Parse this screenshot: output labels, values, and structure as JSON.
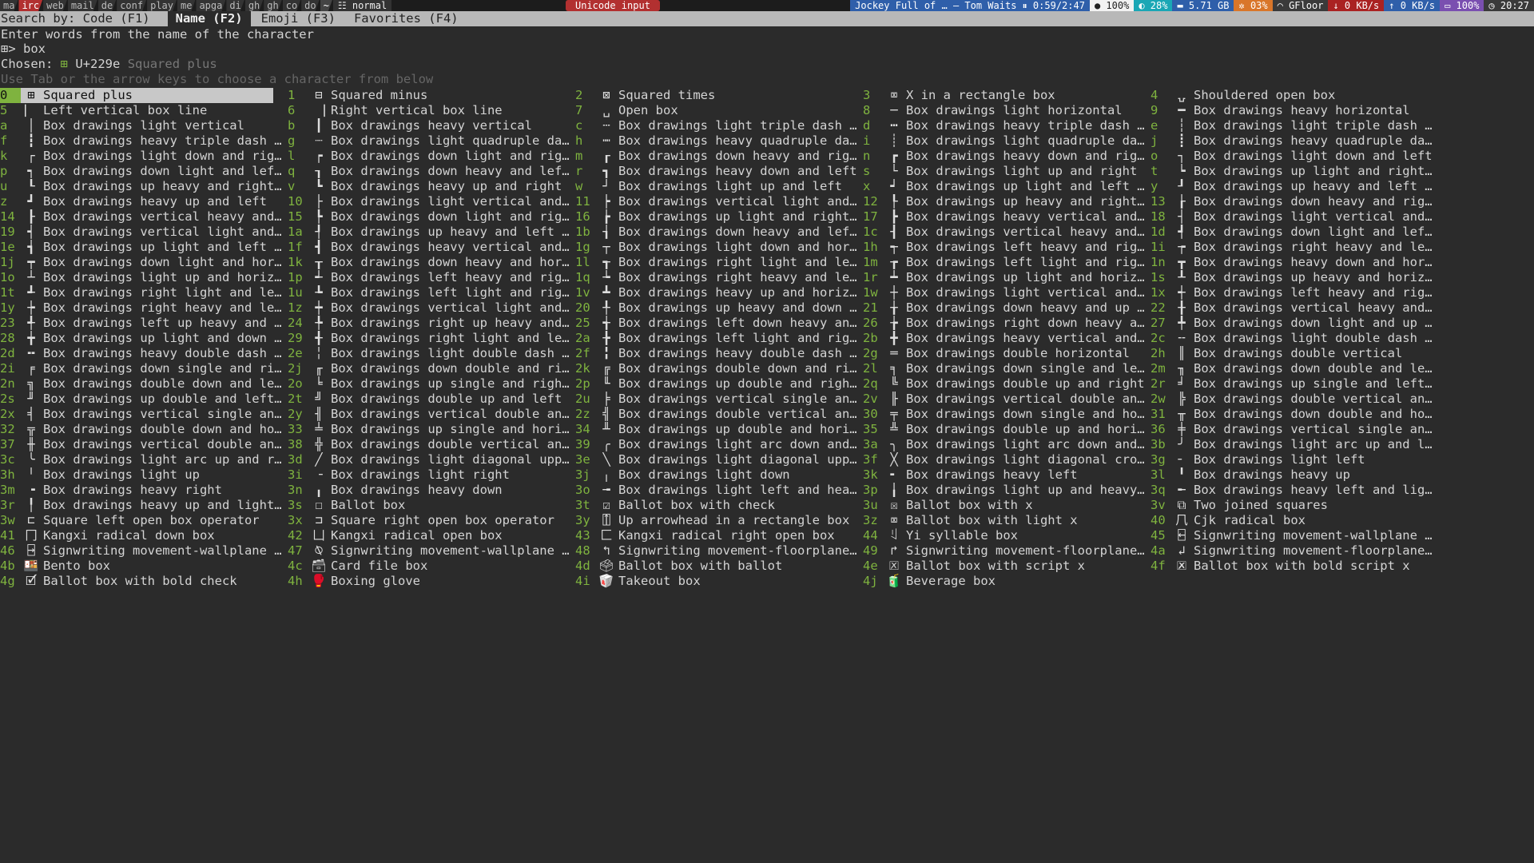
{
  "statusbar": {
    "workspaces": [
      "ma",
      "irc",
      "web",
      "mail",
      "de",
      "conf",
      "play",
      "me",
      "apga",
      "di",
      "gh",
      "gh",
      "co",
      "do",
      "~"
    ],
    "active_workspace": "irc",
    "mode": "normal",
    "mode_icon": "layout-icon",
    "center_title": "Unicode input",
    "now_playing": "Jockey Full of … — Tom Waits",
    "time_position": "0:59/2:47",
    "vol": "100%",
    "cpu": "28%",
    "mem": "5.71 GB",
    "temp": "03%",
    "wifi": "GFloor",
    "down": "0 KB/s",
    "up": "0 KB/s",
    "battery": "100%",
    "clock": "20:27"
  },
  "tabs": [
    {
      "label": "Search by: Code (F1)",
      "active": false
    },
    {
      "label": "Name (F2)",
      "active": true
    },
    {
      "label": "Emoji (F3)",
      "active": false
    },
    {
      "label": "Favorites (F4)",
      "active": false
    }
  ],
  "hint": "Enter words from the name of the character",
  "prompt": {
    "glyph": "⊞>",
    "value": "box"
  },
  "chosen": {
    "label": "Chosen:",
    "glyph": "⊞",
    "code": "U+229e",
    "name": "Squared plus"
  },
  "help": "Use Tab or the arrow keys to choose a character from below",
  "colors": {
    "accent": "#7fb33f",
    "background": "#2b2b2b",
    "tabbar": "#b8b8b8",
    "title": "#b23030"
  },
  "results": [
    [
      "0",
      "⊞",
      "Squared plus"
    ],
    [
      "1",
      "⊟",
      "Squared minus"
    ],
    [
      "2",
      "⊠",
      "Squared times"
    ],
    [
      "3",
      "⌧",
      "X in a rectangle box"
    ],
    [
      "4",
      "⍽",
      "Shouldered open box"
    ],
    [
      "5",
      "⎸",
      "Left vertical box line"
    ],
    [
      "6",
      "⎹",
      "Right vertical box line"
    ],
    [
      "7",
      "␣",
      "Open box"
    ],
    [
      "8",
      "─",
      "Box drawings light horizontal"
    ],
    [
      "9",
      "━",
      "Box drawings heavy horizontal"
    ],
    [
      "a",
      "│",
      "Box drawings light vertical"
    ],
    [
      "b",
      "┃",
      "Box drawings heavy vertical"
    ],
    [
      "c",
      "┄",
      "Box drawings light triple dash …"
    ],
    [
      "d",
      "┅",
      "Box drawings heavy triple dash …"
    ],
    [
      "e",
      "┆",
      "Box drawings light triple dash …"
    ],
    [
      "f",
      "┇",
      "Box drawings heavy triple dash …"
    ],
    [
      "g",
      "┈",
      "Box drawings light quadruple da…"
    ],
    [
      "h",
      "┉",
      "Box drawings heavy quadruple da…"
    ],
    [
      "i",
      "┊",
      "Box drawings light quadruple da…"
    ],
    [
      "j",
      "┋",
      "Box drawings heavy quadruple da…"
    ],
    [
      "k",
      "┌",
      "Box drawings light down and rig…"
    ],
    [
      "l",
      "┍",
      "Box drawings down light and rig…"
    ],
    [
      "m",
      "┎",
      "Box drawings down heavy and rig…"
    ],
    [
      "n",
      "┏",
      "Box drawings heavy down and rig…"
    ],
    [
      "o",
      "┐",
      "Box drawings light down and left"
    ],
    [
      "p",
      "┑",
      "Box drawings down light and lef…"
    ],
    [
      "q",
      "┒",
      "Box drawings down heavy and lef…"
    ],
    [
      "r",
      "┓",
      "Box drawings heavy down and left"
    ],
    [
      "s",
      "└",
      "Box drawings light up and right"
    ],
    [
      "t",
      "┕",
      "Box drawings up light and right…"
    ],
    [
      "u",
      "┖",
      "Box drawings up heavy and right…"
    ],
    [
      "v",
      "┗",
      "Box drawings heavy up and right"
    ],
    [
      "w",
      "┘",
      "Box drawings light up and left"
    ],
    [
      "x",
      "┙",
      "Box drawings up light and left …"
    ],
    [
      "y",
      "┚",
      "Box drawings up heavy and left …"
    ],
    [
      "z",
      "┛",
      "Box drawings heavy up and left"
    ],
    [
      "10",
      "├",
      "Box drawings light vertical and…"
    ],
    [
      "11",
      "┝",
      "Box drawings vertical light and…"
    ],
    [
      "12",
      "┞",
      "Box drawings up heavy and right…"
    ],
    [
      "13",
      "┟",
      "Box drawings down heavy and rig…"
    ],
    [
      "14",
      "┠",
      "Box drawings vertical heavy and…"
    ],
    [
      "15",
      "┡",
      "Box drawings down light and rig…"
    ],
    [
      "16",
      "┢",
      "Box drawings up light and right…"
    ],
    [
      "17",
      "┣",
      "Box drawings heavy vertical and…"
    ],
    [
      "18",
      "┤",
      "Box drawings light vertical and…"
    ],
    [
      "19",
      "┥",
      "Box drawings vertical light and…"
    ],
    [
      "1a",
      "┦",
      "Box drawings up heavy and left …"
    ],
    [
      "1b",
      "┧",
      "Box drawings down heavy and lef…"
    ],
    [
      "1c",
      "┨",
      "Box drawings vertical heavy and…"
    ],
    [
      "1d",
      "┩",
      "Box drawings down light and lef…"
    ],
    [
      "1e",
      "┪",
      "Box drawings up light and left …"
    ],
    [
      "1f",
      "┫",
      "Box drawings heavy vertical and…"
    ],
    [
      "1g",
      "┬",
      "Box drawings light down and hor…"
    ],
    [
      "1h",
      "┭",
      "Box drawings left heavy and rig…"
    ],
    [
      "1i",
      "┮",
      "Box drawings right heavy and le…"
    ],
    [
      "1j",
      "┯",
      "Box drawings down light and hor…"
    ],
    [
      "1k",
      "┰",
      "Box drawings down heavy and hor…"
    ],
    [
      "1l",
      "┱",
      "Box drawings right light and le…"
    ],
    [
      "1m",
      "┲",
      "Box drawings left light and rig…"
    ],
    [
      "1n",
      "┳",
      "Box drawings heavy down and hor…"
    ],
    [
      "1o",
      "┴",
      "Box drawings light up and horiz…"
    ],
    [
      "1p",
      "┵",
      "Box drawings left heavy and rig…"
    ],
    [
      "1q",
      "┶",
      "Box drawings right heavy and le…"
    ],
    [
      "1r",
      "┷",
      "Box drawings up light and horiz…"
    ],
    [
      "1s",
      "┸",
      "Box drawings up heavy and horiz…"
    ],
    [
      "1t",
      "┹",
      "Box drawings right light and le…"
    ],
    [
      "1u",
      "┺",
      "Box drawings left light and rig…"
    ],
    [
      "1v",
      "┻",
      "Box drawings heavy up and horiz…"
    ],
    [
      "1w",
      "┼",
      "Box drawings light vertical and…"
    ],
    [
      "1x",
      "┽",
      "Box drawings left heavy and rig…"
    ],
    [
      "1y",
      "┾",
      "Box drawings right heavy and le…"
    ],
    [
      "1z",
      "┿",
      "Box drawings vertical light and…"
    ],
    [
      "20",
      "╀",
      "Box drawings up heavy and down …"
    ],
    [
      "21",
      "╁",
      "Box drawings down heavy and up …"
    ],
    [
      "22",
      "╂",
      "Box drawings vertical heavy and…"
    ],
    [
      "23",
      "╃",
      "Box drawings left up heavy and …"
    ],
    [
      "24",
      "╄",
      "Box drawings right up heavy and…"
    ],
    [
      "25",
      "╅",
      "Box drawings left down heavy an…"
    ],
    [
      "26",
      "╆",
      "Box drawings right down heavy a…"
    ],
    [
      "27",
      "╇",
      "Box drawings down light and up …"
    ],
    [
      "28",
      "╈",
      "Box drawings up light and down …"
    ],
    [
      "29",
      "╉",
      "Box drawings right light and le…"
    ],
    [
      "2a",
      "╊",
      "Box drawings left light and rig…"
    ],
    [
      "2b",
      "╋",
      "Box drawings heavy vertical and…"
    ],
    [
      "2c",
      "╌",
      "Box drawings light double dash …"
    ],
    [
      "2d",
      "╍",
      "Box drawings heavy double dash …"
    ],
    [
      "2e",
      "╎",
      "Box drawings light double dash …"
    ],
    [
      "2f",
      "╏",
      "Box drawings heavy double dash …"
    ],
    [
      "2g",
      "═",
      "Box drawings double horizontal"
    ],
    [
      "2h",
      "║",
      "Box drawings double vertical"
    ],
    [
      "2i",
      "╒",
      "Box drawings down single and ri…"
    ],
    [
      "2j",
      "╓",
      "Box drawings down double and ri…"
    ],
    [
      "2k",
      "╔",
      "Box drawings double down and ri…"
    ],
    [
      "2l",
      "╕",
      "Box drawings down single and le…"
    ],
    [
      "2m",
      "╖",
      "Box drawings down double and le…"
    ],
    [
      "2n",
      "╗",
      "Box drawings double down and le…"
    ],
    [
      "2o",
      "╘",
      "Box drawings up single and righ…"
    ],
    [
      "2p",
      "╙",
      "Box drawings up double and righ…"
    ],
    [
      "2q",
      "╚",
      "Box drawings double up and right"
    ],
    [
      "2r",
      "╛",
      "Box drawings up single and left…"
    ],
    [
      "2s",
      "╜",
      "Box drawings up double and left…"
    ],
    [
      "2t",
      "╝",
      "Box drawings double up and left"
    ],
    [
      "2u",
      "╞",
      "Box drawings vertical single an…"
    ],
    [
      "2v",
      "╟",
      "Box drawings vertical double an…"
    ],
    [
      "2w",
      "╠",
      "Box drawings double vertical an…"
    ],
    [
      "2x",
      "╡",
      "Box drawings vertical single an…"
    ],
    [
      "2y",
      "╢",
      "Box drawings vertical double an…"
    ],
    [
      "2z",
      "╣",
      "Box drawings double vertical an…"
    ],
    [
      "30",
      "╤",
      "Box drawings down single and ho…"
    ],
    [
      "31",
      "╥",
      "Box drawings down double and ho…"
    ],
    [
      "32",
      "╦",
      "Box drawings double down and ho…"
    ],
    [
      "33",
      "╧",
      "Box drawings up single and hori…"
    ],
    [
      "34",
      "╨",
      "Box drawings up double and hori…"
    ],
    [
      "35",
      "╩",
      "Box drawings double up and hori…"
    ],
    [
      "36",
      "╪",
      "Box drawings vertical single an…"
    ],
    [
      "37",
      "╫",
      "Box drawings vertical double an…"
    ],
    [
      "38",
      "╬",
      "Box drawings double vertical an…"
    ],
    [
      "39",
      "╭",
      "Box drawings light arc down and…"
    ],
    [
      "3a",
      "╮",
      "Box drawings light arc down and…"
    ],
    [
      "3b",
      "╯",
      "Box drawings light arc up and l…"
    ],
    [
      "3c",
      "╰",
      "Box drawings light arc up and r…"
    ],
    [
      "3d",
      "╱",
      "Box drawings light diagonal upp…"
    ],
    [
      "3e",
      "╲",
      "Box drawings light diagonal upp…"
    ],
    [
      "3f",
      "╳",
      "Box drawings light diagonal cro…"
    ],
    [
      "3g",
      "╴",
      "Box drawings light left"
    ],
    [
      "3h",
      "╵",
      "Box drawings light up"
    ],
    [
      "3i",
      "╶",
      "Box drawings light right"
    ],
    [
      "3j",
      "╷",
      "Box drawings light down"
    ],
    [
      "3k",
      "╸",
      "Box drawings heavy left"
    ],
    [
      "3l",
      "╹",
      "Box drawings heavy up"
    ],
    [
      "3m",
      "╺",
      "Box drawings heavy right"
    ],
    [
      "3n",
      "╻",
      "Box drawings heavy down"
    ],
    [
      "3o",
      "╼",
      "Box drawings light left and hea…"
    ],
    [
      "3p",
      "╽",
      "Box drawings light up and heavy…"
    ],
    [
      "3q",
      "╾",
      "Box drawings heavy left and lig…"
    ],
    [
      "3r",
      "╿",
      "Box drawings heavy up and light…"
    ],
    [
      "3s",
      "☐",
      "Ballot box"
    ],
    [
      "3t",
      "☑",
      "Ballot box with check"
    ],
    [
      "3u",
      "☒",
      "Ballot box with x"
    ],
    [
      "3v",
      "⧉",
      "Two joined squares"
    ],
    [
      "3w",
      "⊏",
      "Square left open box operator"
    ],
    [
      "3x",
      "⊐",
      "Square right open box operator"
    ],
    [
      "3y",
      "⍐",
      "Up arrowhead in a rectangle box"
    ],
    [
      "3z",
      "⌧",
      "Ballot box with light x"
    ],
    [
      "40",
      "⺇",
      "Cjk radical box"
    ],
    [
      "41",
      "⼌",
      "Kangxi radical down box"
    ],
    [
      "42",
      "⼐",
      "Kangxi radical open box"
    ],
    [
      "43",
      "⼕",
      "Kangxi radical right open box"
    ],
    [
      "44",
      "ꆹ",
      "Yi syllable box"
    ],
    [
      "45",
      "⍇",
      "Signwriting movement-wallplane …"
    ],
    [
      "46",
      "⍈",
      "Signwriting movement-wallplane …"
    ],
    [
      "47",
      "⍉",
      "Signwriting movement-wallplane …"
    ],
    [
      "48",
      "↰",
      "Signwriting movement-floorplane…"
    ],
    [
      "49",
      "↱",
      "Signwriting movement-floorplane…"
    ],
    [
      "4a",
      "↲",
      "Signwriting movement-floorplane…"
    ],
    [
      "4b",
      "🍱",
      "Bento box"
    ],
    [
      "4c",
      "🗃",
      "Card file box"
    ],
    [
      "4d",
      "🗳",
      "Ballot box with ballot"
    ],
    [
      "4e",
      "🗵",
      "Ballot box with script x"
    ],
    [
      "4f",
      "🗷",
      "Ballot box with bold script x"
    ],
    [
      "4g",
      "🗹",
      "Ballot box with bold check"
    ],
    [
      "4h",
      "🥊",
      "Boxing glove"
    ],
    [
      "4i",
      "🥡",
      "Takeout box"
    ],
    [
      "4j",
      "🧃",
      "Beverage box"
    ]
  ]
}
